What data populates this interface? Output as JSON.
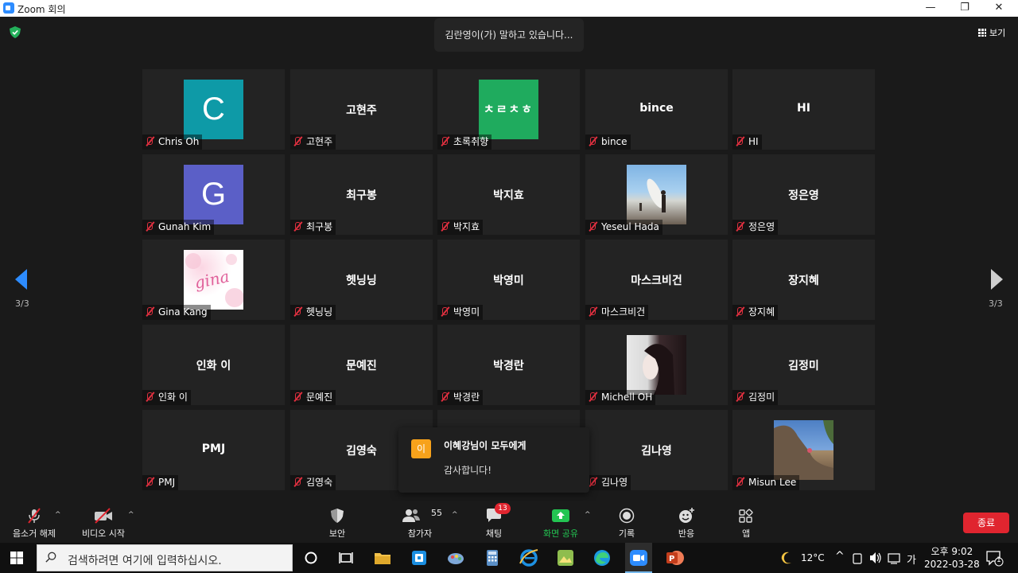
{
  "window": {
    "title": "Zoom 회의",
    "minimize": "—",
    "restore": "❐",
    "close": "✕"
  },
  "header": {
    "speaking_indicator": "김란영이(가) 말하고 있습니다...",
    "view_label": "보기"
  },
  "pager": {
    "left": "3/3",
    "right": "3/3"
  },
  "tiles": [
    {
      "label": "Chris Oh",
      "avatar_type": "letter",
      "avatar_text": "C",
      "avatar_color": "#0e9aa7"
    },
    {
      "label": "고현주",
      "big": "고현주"
    },
    {
      "label": "초록취향",
      "avatar_type": "letter",
      "avatar_text": "ㅊㄹㅊㅎ",
      "avatar_color": "#1fab5e"
    },
    {
      "label": "bince",
      "big": "bince"
    },
    {
      "label": "HI",
      "big": "HI"
    },
    {
      "label": "Gunah Kim",
      "avatar_type": "letter",
      "avatar_text": "G",
      "avatar_color": "#5b5fc7"
    },
    {
      "label": "최구봉",
      "big": "최구봉"
    },
    {
      "label": "박지효",
      "big": "박지효"
    },
    {
      "label": "Yeseul Hada",
      "avatar_type": "photo-beach"
    },
    {
      "label": "정은영",
      "big": "정은영"
    },
    {
      "label": "Gina Kang",
      "avatar_type": "photo-gina",
      "avatar_text": "gina"
    },
    {
      "label": "헷닝닝",
      "big": "헷닝닝"
    },
    {
      "label": "박영미",
      "big": "박영미"
    },
    {
      "label": "마스크비건",
      "big": "마스크비건"
    },
    {
      "label": "장지혜",
      "big": "장지혜"
    },
    {
      "label": "인화 이",
      "big": "인화 이"
    },
    {
      "label": "문예진",
      "big": "문예진"
    },
    {
      "label": "박경란",
      "big": "박경란"
    },
    {
      "label": "Michell OH",
      "avatar_type": "photo-portrait"
    },
    {
      "label": "김정미",
      "big": "김정미"
    },
    {
      "label": "PMJ",
      "big": "PMJ"
    },
    {
      "label": "김영숙",
      "big": "김영숙"
    },
    {
      "label": "",
      "big": ""
    },
    {
      "label": "김나영",
      "big": "김나영"
    },
    {
      "label": "Misun Lee",
      "avatar_type": "photo-rock"
    }
  ],
  "chat_popup": {
    "avatar_text": "이",
    "from": "이혜강님이 모두에게",
    "message": "감사합니다!"
  },
  "toolbar": {
    "mute": "음소거 해제",
    "video": "비디오 시작",
    "security": "보안",
    "participants": "참가자",
    "participants_count": "55",
    "chat": "채팅",
    "chat_badge": "13",
    "share": "화면 공유",
    "record": "기록",
    "reactions": "반응",
    "apps": "앱",
    "end": "종료"
  },
  "taskbar": {
    "search_placeholder": "검색하려면 여기에 입력하십시오.",
    "weather": "12°C",
    "ime": "가",
    "time": "오후 9:02",
    "date": "2022-03-28",
    "notif_count": "1"
  }
}
